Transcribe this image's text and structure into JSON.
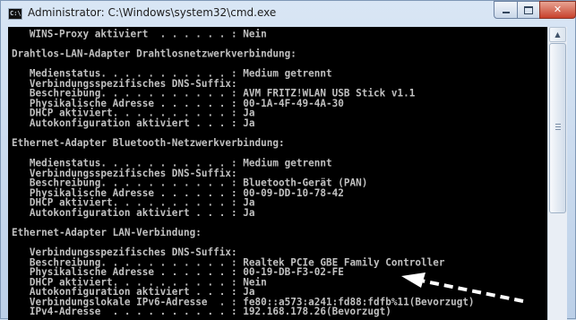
{
  "window": {
    "title": "Administrator: C:\\Windows\\system32\\cmd.exe",
    "icon_name": "cmd-icon",
    "icon_text": "C:\\",
    "controls": {
      "minimize": "minimize-icon",
      "maximize": "maximize-icon",
      "close": "close-icon",
      "close_glyph": "✕"
    }
  },
  "console": {
    "lines": [
      "   WINS-Proxy aktiviert  . . . . . . : Nein",
      "",
      "Drahtlos-LAN-Adapter Drahtlosnetzwerkverbindung:",
      "",
      "   Medienstatus. . . . . . . . . . . : Medium getrennt",
      "   Verbindungsspezifisches DNS-Suffix:",
      "   Beschreibung. . . . . . . . . . . : AVM FRITZ!WLAN USB Stick v1.1",
      "   Physikalische Adresse . . . . . . : 00-1A-4F-49-4A-30",
      "   DHCP aktiviert. . . . . . . . . . : Ja",
      "   Autokonfiguration aktiviert . . . : Ja",
      "",
      "Ethernet-Adapter Bluetooth-Netzwerkverbindung:",
      "",
      "   Medienstatus. . . . . . . . . . . : Medium getrennt",
      "   Verbindungsspezifisches DNS-Suffix:",
      "   Beschreibung. . . . . . . . . . . : Bluetooth-Gerät (PAN)",
      "   Physikalische Adresse . . . . . . : 00-09-DD-10-78-42",
      "   DHCP aktiviert. . . . . . . . . . : Ja",
      "   Autokonfiguration aktiviert . . . : Ja",
      "",
      "Ethernet-Adapter LAN-Verbindung:",
      "",
      "   Verbindungsspezifisches DNS-Suffix:",
      "   Beschreibung. . . . . . . . . . . : Realtek PCIe GBE Family Controller",
      "   Physikalische Adresse . . . . . . : 00-19-DB-F3-02-FE",
      "   DHCP aktiviert. . . . . . . . . . : Nein",
      "   Autokonfiguration aktiviert . . . : Ja",
      "   Verbindungslokale IPv6-Adresse  . : fe80::a573:a241:fd88:fdfb%11(Bevorzugt)",
      "   IPv4-Adresse  . . . . . . . . . . : 192.168.178.26(Bevorzugt)"
    ],
    "background": "#000000",
    "text_color": "#c0c0c0"
  },
  "scrollbar": {
    "up_glyph": "▲",
    "up_icon": "scroll-up-arrow-icon"
  },
  "annotation": {
    "icon": "dashed-arrow-icon",
    "color": "#ffffff"
  }
}
